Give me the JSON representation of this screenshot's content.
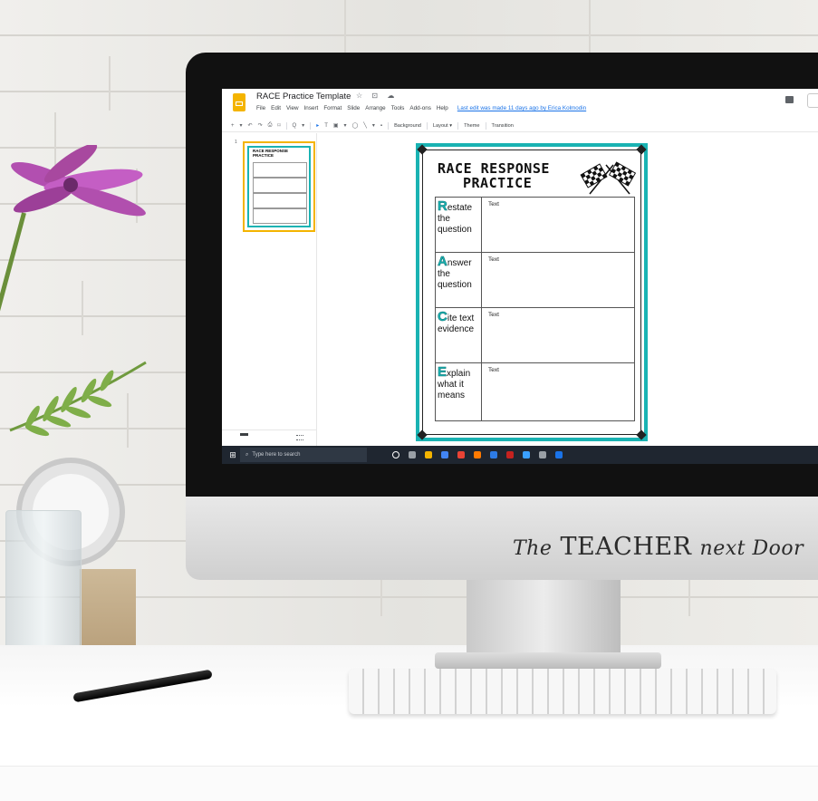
{
  "app": {
    "title": "RACE Practice Template",
    "title_icons": "☆ ⊡ ☁",
    "last_edit": "Last edit was made 11 days ago by Erica Kolmodin",
    "menu": [
      "File",
      "Edit",
      "View",
      "Insert",
      "Format",
      "Slide",
      "Arrange",
      "Tools",
      "Add-ons",
      "Help"
    ]
  },
  "toolbar": {
    "items": [
      "+",
      "▾",
      "↶",
      "↷",
      "⎙",
      "⌑",
      "Q",
      "▾",
      "▸",
      "T",
      "▣",
      "▾",
      "◯",
      "╲",
      "▾",
      "▪"
    ],
    "background_label": "Background",
    "layout_label": "Layout ▾",
    "theme_label": "Theme",
    "transition_label": "Transition"
  },
  "filmstrip": {
    "slide_number": "1",
    "thumb_title": "RACE RESPONSE PRACTICE"
  },
  "slide": {
    "title_line1": "RACE RESPONSE",
    "title_line2": "PRACTICE",
    "rows": [
      {
        "letter": "R",
        "rest": "estate the question",
        "text": "Text"
      },
      {
        "letter": "A",
        "rest": "nswer the question",
        "text": "Text"
      },
      {
        "letter": "C",
        "rest": "ite text evidence",
        "text": "Text"
      },
      {
        "letter": "E",
        "rest": "xplain what it means",
        "text": "Text"
      }
    ]
  },
  "taskbar": {
    "search_placeholder": "Type here to search",
    "icon_colors": [
      "#ffffff",
      "#9aa0a6",
      "#f4b400",
      "#4285f4",
      "#ea4335",
      "#ff7a00",
      "#2d7be5",
      "#c5221f",
      "#3aa0ff",
      "#9aa0a6",
      "#1a73e8"
    ]
  },
  "brand": {
    "prefix": "The",
    "main": "TEACHER",
    "suffix": "next Door"
  },
  "colors": {
    "accent": "#1ab3b3",
    "slides_yellow": "#f4b400"
  }
}
